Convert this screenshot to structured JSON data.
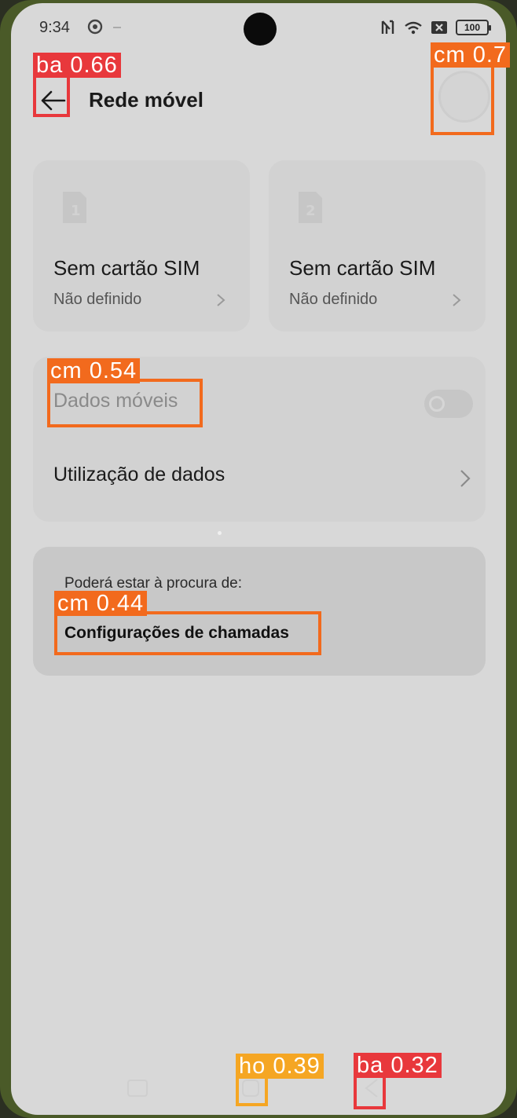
{
  "status_bar": {
    "time": "9:34",
    "battery": "100",
    "icons": [
      "gear-icon",
      "nfc-icon",
      "wifi-icon",
      "no-sim-icon",
      "battery-icon"
    ]
  },
  "header": {
    "title": "Rede móvel",
    "back_icon": "arrow-left-icon"
  },
  "sim_cards": [
    {
      "slot": "1",
      "title": "Sem cartão SIM",
      "subtitle": "Não definido"
    },
    {
      "slot": "2",
      "title": "Sem cartão SIM",
      "subtitle": "Não definido"
    }
  ],
  "data_settings": {
    "mobile_data_label": "Dados móveis",
    "mobile_data_enabled": false,
    "data_usage_label": "Utilização de dados"
  },
  "suggestion": {
    "hint": "Poderá estar à procura de:",
    "link": "Configurações de chamadas"
  },
  "detections": [
    {
      "label": "ba 0.66",
      "color": "#e8383c"
    },
    {
      "label": "cm 0.7",
      "color": "#f26a1d"
    },
    {
      "label": "cm 0.54",
      "color": "#f26a1d"
    },
    {
      "label": "cm 0.44",
      "color": "#f26a1d"
    },
    {
      "label": "ho 0.39",
      "color": "#f5a623"
    },
    {
      "label": "ba 0.32",
      "color": "#e8383c"
    }
  ]
}
